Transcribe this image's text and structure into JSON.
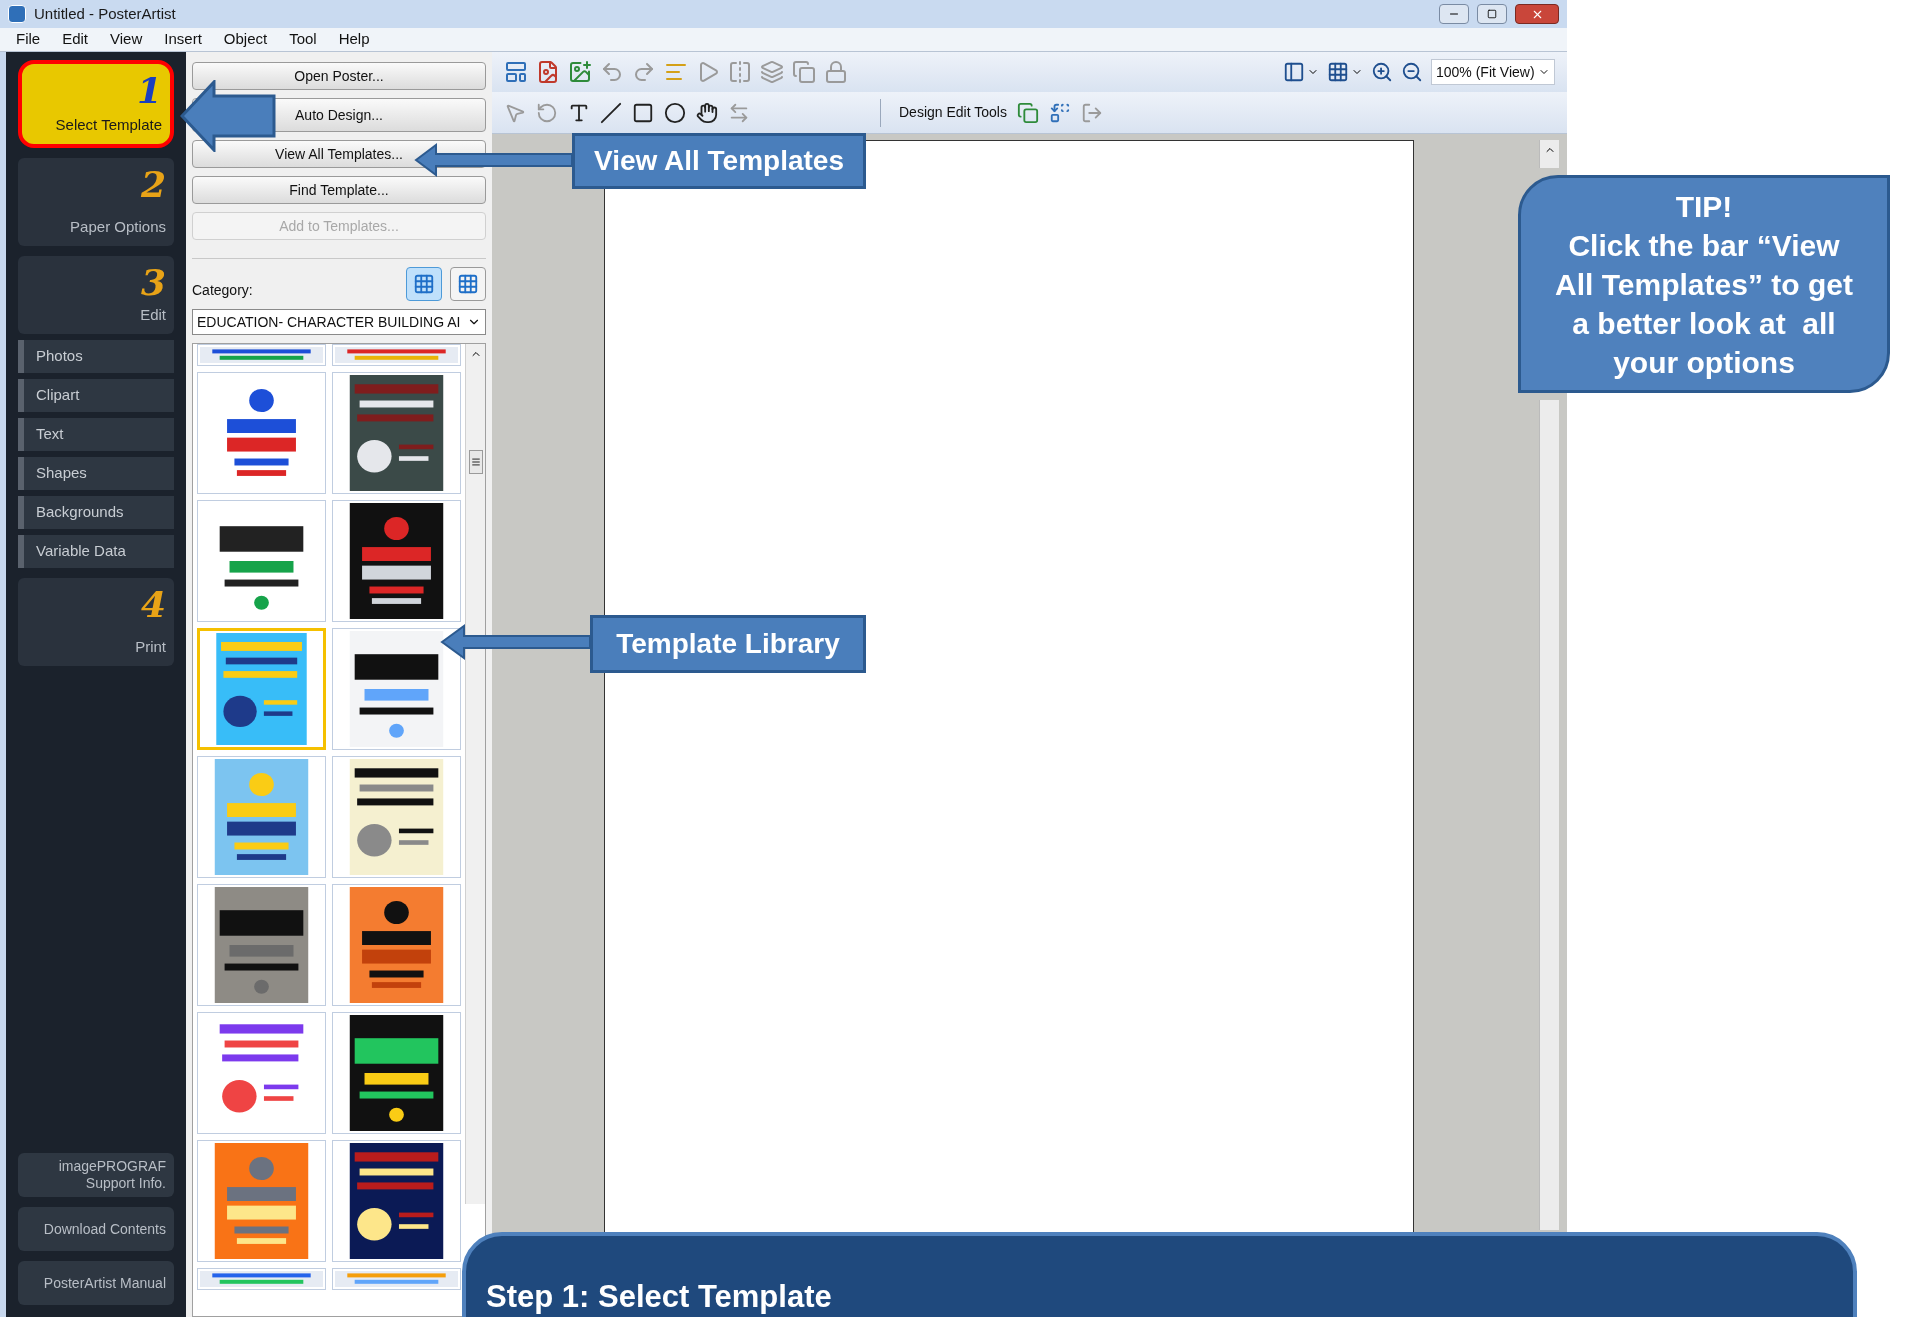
{
  "window": {
    "title": "Untitled - PosterArtist"
  },
  "menu": [
    "File",
    "Edit",
    "View",
    "Insert",
    "Object",
    "Tool",
    "Help"
  ],
  "sidebar": {
    "steps": [
      {
        "number": "1",
        "label": "Select Template",
        "selected": true
      },
      {
        "number": "2",
        "label": "Paper Options",
        "selected": false
      },
      {
        "number": "3",
        "label": "Edit",
        "selected": false,
        "children": [
          {
            "label": "Photos"
          },
          {
            "label": "Clipart"
          },
          {
            "label": "Text"
          },
          {
            "label": "Shapes"
          },
          {
            "label": "Backgrounds"
          },
          {
            "label": "Variable Data"
          }
        ]
      },
      {
        "number": "4",
        "label": "Print",
        "selected": false
      }
    ],
    "links": [
      "imagePROGRAF Support Info.",
      "Download Contents",
      "PosterArtist Manual"
    ]
  },
  "template_panel": {
    "buttons": [
      {
        "label": "Open Poster...",
        "disabled": false
      },
      {
        "label": "Auto Design...",
        "disabled": false
      },
      {
        "label": "View All Templates...",
        "disabled": false
      },
      {
        "label": "Find Template...",
        "disabled": false
      },
      {
        "label": "Add to Templates...",
        "disabled": true
      }
    ],
    "view_modes": [
      {
        "selected": true
      },
      {
        "selected": false
      }
    ],
    "category_label": "Category:",
    "category": "EDUCATION- CHARACTER BUILDING AI",
    "thumbnails": [
      {
        "selected": false
      },
      {
        "selected": false
      },
      {
        "selected": false
      },
      {
        "selected": false
      },
      {
        "selected": false
      },
      {
        "selected": false
      },
      {
        "selected": true
      },
      {
        "selected": false
      },
      {
        "selected": false
      },
      {
        "selected": false
      },
      {
        "selected": false
      },
      {
        "selected": false
      },
      {
        "selected": false
      },
      {
        "selected": false
      },
      {
        "selected": false
      },
      {
        "selected": false
      },
      {
        "selected": false
      },
      {
        "selected": false
      }
    ]
  },
  "toolbar": {
    "top_tools": [
      {
        "disabled": false
      },
      {
        "disabled": false
      },
      {
        "disabled": false
      },
      {
        "disabled": true
      },
      {
        "disabled": true
      },
      {
        "disabled": false
      },
      {
        "disabled": true
      },
      {
        "disabled": true
      },
      {
        "disabled": true
      },
      {
        "disabled": true
      },
      {
        "disabled": true
      }
    ],
    "view_tools": [
      {
        "disabled": false
      },
      {
        "disabled": false
      },
      {
        "disabled": false
      },
      {
        "disabled": false
      }
    ],
    "zoom": "100% (Fit View)",
    "draw_tools": [
      {
        "disabled": true
      },
      {
        "disabled": true
      },
      {
        "disabled": false
      },
      {
        "disabled": false
      },
      {
        "disabled": false
      },
      {
        "disabled": false
      },
      {
        "disabled": false
      },
      {
        "disabled": true
      }
    ],
    "design_label": "Design Edit Tools",
    "design_tools": [
      {
        "disabled": false
      },
      {
        "disabled": false
      },
      {
        "disabled": true
      }
    ]
  },
  "annotations": {
    "view_all_callout": "View All Templates",
    "library_callout": "Template Library",
    "tip_title": "TIP!",
    "tip_text": "Click the bar “View All Templates” to get a better look at  all your options",
    "step_banner": "Step 1: Select Template"
  }
}
